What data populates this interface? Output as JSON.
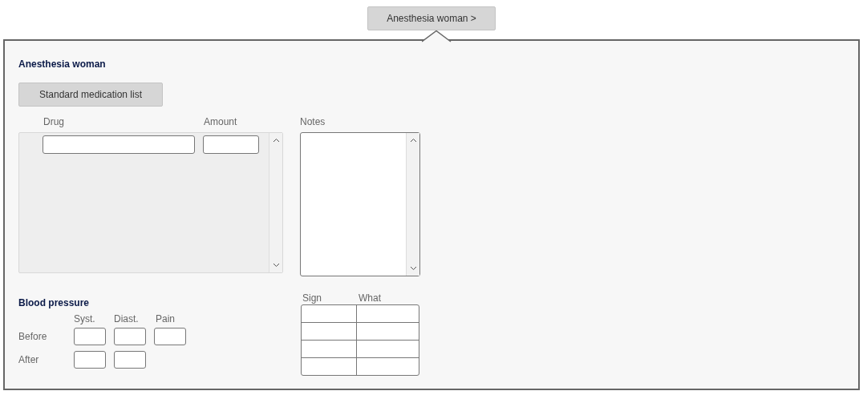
{
  "top_button": {
    "label": "Anesthesia woman >"
  },
  "panel": {
    "title": "Anesthesia woman",
    "standard_button": "Standard medication list",
    "medications": {
      "columns": [
        "Drug",
        "Amount"
      ]
    },
    "notes": {
      "label": "Notes"
    },
    "blood_pressure": {
      "title": "Blood pressure",
      "columns": [
        "Syst.",
        "Diast.",
        "Pain"
      ],
      "rows": [
        {
          "label": "Before",
          "has_pain": true
        },
        {
          "label": "After",
          "has_pain": false
        }
      ]
    },
    "signs": {
      "columns": [
        "Sign",
        "What"
      ],
      "rows": [
        {
          "kind": "empty"
        },
        {
          "kind": "empty"
        },
        {
          "kind": "empty"
        },
        {
          "kind": "empty"
        }
      ]
    }
  }
}
